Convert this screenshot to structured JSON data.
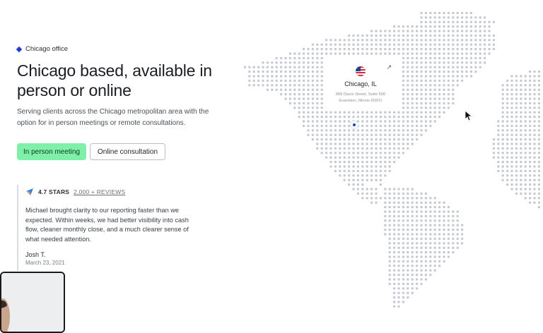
{
  "eyebrow": {
    "label": "Chicago office",
    "marker_color": "#1d3fd1"
  },
  "hero": {
    "headline": "Chicago based, available in person or online",
    "subcopy": "Serving clients across the Chicago metropolitan area with the option for in person meetings or remote consultations."
  },
  "actions": {
    "primary_label": "In person meeting",
    "secondary_label": "Online consultation",
    "primary_color": "#7ef0a7"
  },
  "review": {
    "rating_text": "4.7 STARS",
    "reviews_link": "2,000 + REVIEWS",
    "quote": "Michael brought clarity to our reporting faster than we expected. Within weeks, we had better visibility into cash flow, cleaner monthly close, and a much clearer sense of what needed attention.",
    "author": "Josh T.",
    "date": "March 23, 2021"
  },
  "location_card": {
    "city": "Chicago, IL",
    "address_line1": "909 Davis Street, Suite 500",
    "address_line2": "Evanston, Illinois 60201",
    "flag_icon": "us-flag-icon",
    "link_icon": "external-link-icon"
  },
  "map": {
    "dot_color": "#c5c9cf",
    "pin_color": "#1d3fd1"
  }
}
